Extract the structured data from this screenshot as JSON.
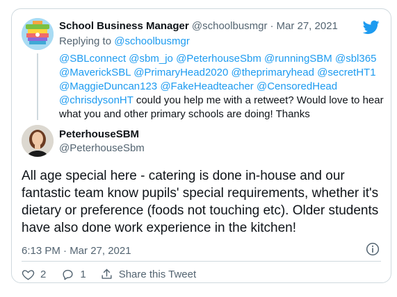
{
  "tweet_original": {
    "display_name": "School Business Manager",
    "handle": "@schoolbusmgr",
    "separator": "·",
    "date": "Mar 27, 2021",
    "replying_to_prefix": "Replying to",
    "replying_to_handle": "@schoolbusmgr",
    "mentions": [
      "@SBLconnect",
      "@sbm_jo",
      "@PeterhouseSbm",
      "@runningSBM",
      "@sbl365",
      "@MaverickSBL",
      "@PrimaryHead2020",
      "@theprimaryhead",
      "@secretHT1",
      "@MaggieDuncan123",
      "@FakeHeadteacher",
      "@CensoredHead",
      "@chrisdysonHT"
    ],
    "text": "could you help me with a retweet? Would love to hear what you and other primary schools are doing! Thanks"
  },
  "tweet_reply": {
    "display_name": "PeterhouseSBM",
    "handle": "@PeterhouseSbm",
    "text": "All age special here - catering is done in-house and our fantastic team know pupils' special requirements, whether it's dietary or preference (foods not touching etc). Older students have also done work experience in the kitchen!",
    "timestamp": "6:13 PM · Mar 27, 2021"
  },
  "actions": {
    "like_count": "2",
    "reply_count": "1",
    "share_label": "Share this Tweet"
  },
  "colors": {
    "accent": "#1d9bf0",
    "secondary_text": "#536471",
    "border": "#cfd9de"
  },
  "icons": [
    "twitter-bird-icon",
    "info-icon",
    "heart-icon",
    "reply-icon",
    "share-icon"
  ]
}
